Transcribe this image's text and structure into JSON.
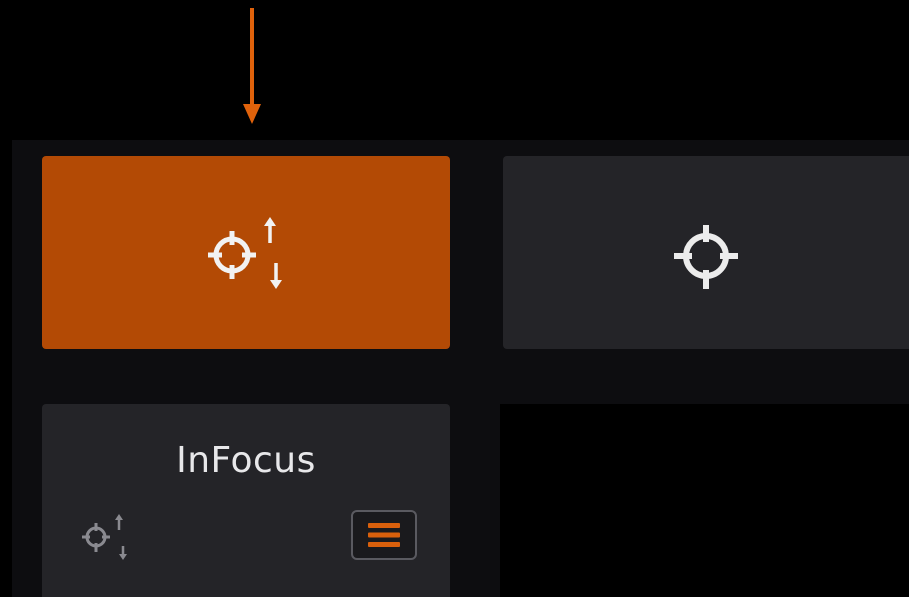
{
  "app": {
    "name": "InFocus"
  },
  "tiles": {
    "focus_adjust": {
      "icon": "crosshair-with-up-down-arrows-icon",
      "active": true
    },
    "focus": {
      "icon": "crosshair-icon",
      "active": false
    }
  },
  "colors": {
    "accent": "#b34a05",
    "arrow": "#e0620b",
    "tile_bg": "#242428",
    "panel_bg": "#0d0d10",
    "icon": "#e8e8ea"
  },
  "icons": {
    "pointer": "down-arrow-icon",
    "menu": "hamburger-menu-icon"
  }
}
